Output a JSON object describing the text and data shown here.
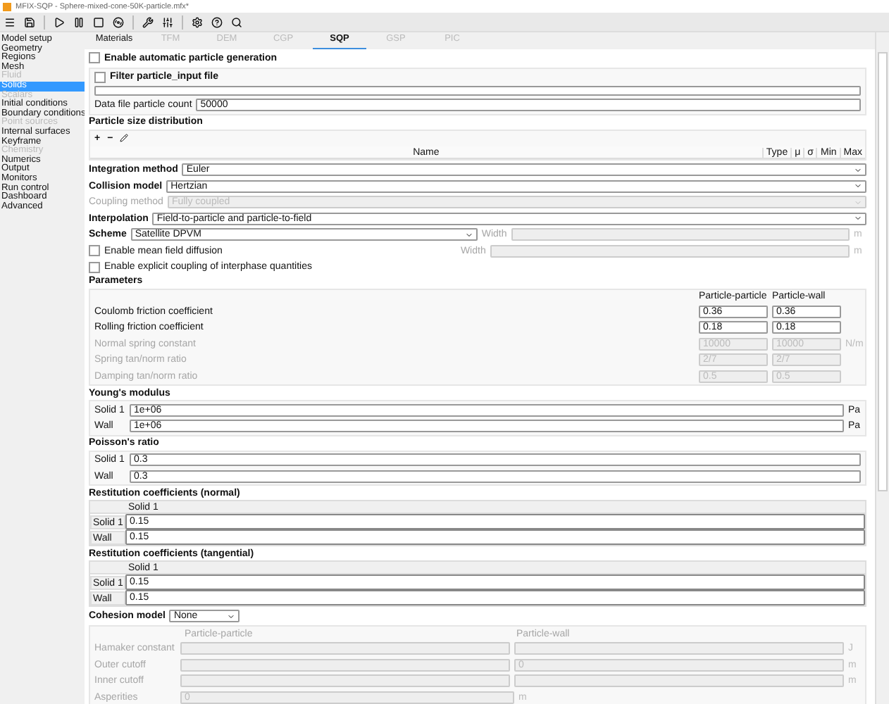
{
  "window": {
    "title": "MFIX-SQP - Sphere-mixed-cone-50K-particle.mfx*"
  },
  "sidebar": {
    "items": [
      {
        "label": "Model setup",
        "selected": false,
        "disabled": false
      },
      {
        "label": "Geometry",
        "selected": false,
        "disabled": false
      },
      {
        "label": "Regions",
        "selected": false,
        "disabled": false
      },
      {
        "label": "Mesh",
        "selected": false,
        "disabled": false
      },
      {
        "label": "Fluid",
        "selected": false,
        "disabled": true
      },
      {
        "label": "Solids",
        "selected": true,
        "disabled": false
      },
      {
        "label": "Scalars",
        "selected": false,
        "disabled": true
      },
      {
        "label": "Initial conditions",
        "selected": false,
        "disabled": false
      },
      {
        "label": "Boundary conditions",
        "selected": false,
        "disabled": false
      },
      {
        "label": "Point sources",
        "selected": false,
        "disabled": true
      },
      {
        "label": "Internal surfaces",
        "selected": false,
        "disabled": false
      },
      {
        "label": "Keyframe",
        "selected": false,
        "disabled": false
      },
      {
        "label": "Chemistry",
        "selected": false,
        "disabled": true
      },
      {
        "label": "Numerics",
        "selected": false,
        "disabled": false
      },
      {
        "label": "Output",
        "selected": false,
        "disabled": false
      },
      {
        "label": "Monitors",
        "selected": false,
        "disabled": false
      },
      {
        "label": "Run control",
        "selected": false,
        "disabled": false
      },
      {
        "label": "Dashboard",
        "selected": false,
        "disabled": false
      },
      {
        "label": "Advanced",
        "selected": false,
        "disabled": false
      }
    ]
  },
  "tabs": [
    {
      "label": "Materials",
      "selected": false,
      "disabled": false
    },
    {
      "label": "TFM",
      "selected": false,
      "disabled": true
    },
    {
      "label": "DEM",
      "selected": false,
      "disabled": true
    },
    {
      "label": "CGP",
      "selected": false,
      "disabled": true
    },
    {
      "label": "SQP",
      "selected": true,
      "disabled": false
    },
    {
      "label": "GSP",
      "selected": false,
      "disabled": true
    },
    {
      "label": "PIC",
      "selected": false,
      "disabled": true
    }
  ],
  "auto_generation": {
    "label": "Enable automatic particle generation",
    "checked": false
  },
  "filter": {
    "label": "Filter particle_input file",
    "checked": false
  },
  "data_file_count": {
    "label": "Data file particle count",
    "value": "50000"
  },
  "psd": {
    "title": "Particle size distribution",
    "actions": [
      "+",
      "−"
    ],
    "columns": [
      "Name",
      "Type",
      "μ",
      "σ",
      "Min",
      "Max"
    ]
  },
  "models": [
    {
      "label": "Integration method",
      "value": "Euler",
      "disabled": false
    },
    {
      "label": "Collision model",
      "value": "Hertzian",
      "disabled": false
    },
    {
      "label": "Coupling method",
      "value": "Fully coupled",
      "disabled": true
    },
    {
      "label": "Interpolation",
      "value": "Field-to-particle and particle-to-field",
      "disabled": false
    }
  ],
  "scheme": {
    "label": "Scheme",
    "value": "Satellite DPVM",
    "width_label": "Width",
    "unit": "m"
  },
  "mean_field": {
    "label": "Enable mean field diffusion",
    "checked": false,
    "width_label": "Width",
    "unit": "m"
  },
  "explicit_coupling": {
    "label": "Enable explicit coupling of interphase quantities",
    "checked": false
  },
  "parameters": {
    "title": "Parameters",
    "columns": [
      "Particle-particle",
      "Particle-wall"
    ],
    "rows": [
      {
        "label": "Coulomb friction coefficient",
        "values": [
          "0.36",
          "0.36"
        ],
        "disabled": false
      },
      {
        "label": "Rolling friction coefficient",
        "values": [
          "0.18",
          "0.18"
        ],
        "disabled": false
      },
      {
        "label": "Normal spring constant",
        "values": [
          "10000",
          "10000"
        ],
        "unit": "N/m",
        "disabled": true
      },
      {
        "label": "Spring tan/norm ratio",
        "values": [
          "2/7",
          "2/7"
        ],
        "disabled": true
      },
      {
        "label": "Damping tan/norm ratio",
        "values": [
          "0.5",
          "0.5"
        ],
        "disabled": true
      }
    ]
  },
  "youngs_modulus": {
    "title": "Young's modulus",
    "rows": [
      {
        "label": "Solid 1",
        "value": "1e+06",
        "unit": "Pa"
      },
      {
        "label": "Wall",
        "value": "1e+06",
        "unit": "Pa"
      }
    ]
  },
  "poisson_ratio": {
    "title": "Poisson's ratio",
    "rows": [
      {
        "label": "Solid 1",
        "value": "0.3"
      },
      {
        "label": "Wall",
        "value": "0.3"
      }
    ]
  },
  "restitution_normal": {
    "title": "Restitution coefficients (normal)",
    "column": "Solid 1",
    "rows": [
      {
        "label": "Solid 1",
        "value": "0.15"
      },
      {
        "label": "Wall",
        "value": "0.15"
      }
    ]
  },
  "restitution_tangential": {
    "title": "Restitution coefficients (tangential)",
    "column": "Solid 1",
    "rows": [
      {
        "label": "Solid 1",
        "value": "0.15"
      },
      {
        "label": "Wall",
        "value": "0.15"
      }
    ]
  },
  "cohesion": {
    "label": "Cohesion model",
    "value": "None",
    "columns": [
      "Particle-particle",
      "Particle-wall"
    ],
    "rows": [
      {
        "label": "Hamaker constant",
        "kind": "pair",
        "unit": "J"
      },
      {
        "label": "Outer cutoff",
        "kind": "pair",
        "particle_wall": "0",
        "unit": "m"
      },
      {
        "label": "Inner cutoff",
        "kind": "pair",
        "unit": "m"
      },
      {
        "label": "Asperities",
        "kind": "single",
        "particle_particle": "0",
        "unit": "m"
      }
    ]
  }
}
